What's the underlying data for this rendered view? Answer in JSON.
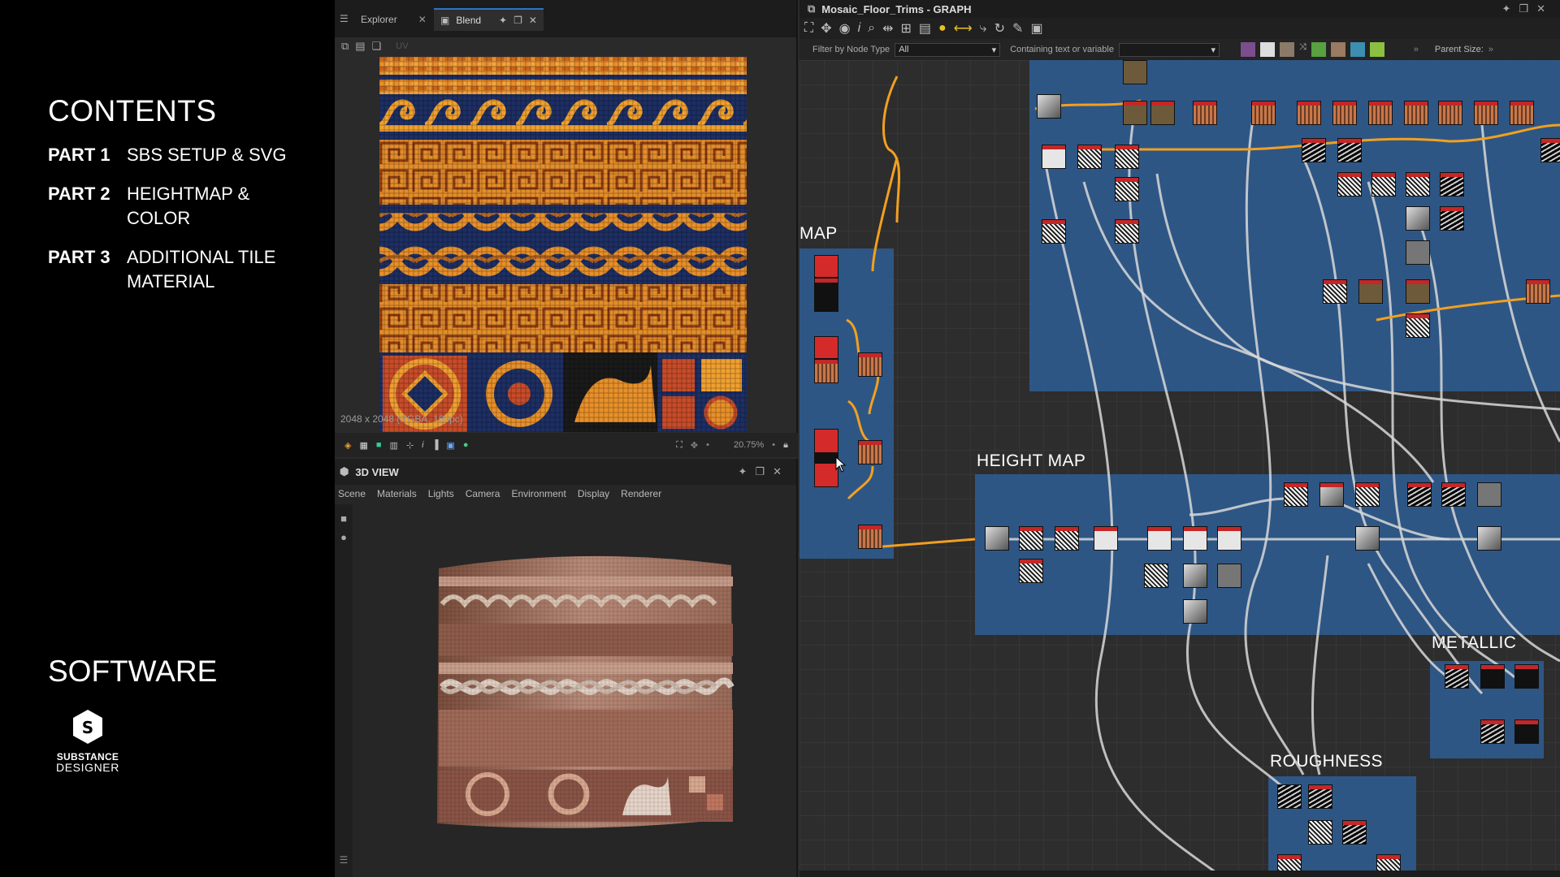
{
  "overlay": {
    "contents_title": "CONTENTS",
    "parts": [
      {
        "num": "PART 1",
        "title": "SBS SETUP & SVG"
      },
      {
        "num": "PART 2",
        "title": "HEIGHTMAP & COLOR"
      },
      {
        "num": "PART 3",
        "title": "ADDITIONAL TILE MATERIAL"
      }
    ],
    "software_title": "SOFTWARE",
    "logo_line1": "SUBSTANCE",
    "logo_line2": "DESIGNER"
  },
  "view2d": {
    "tab_explorer": "Explorer",
    "tab_blend": "Blend",
    "uv_label": "UV",
    "texture_info": "2048 x 2048 (RGBA, 16bpc)",
    "zoom": "20.75%"
  },
  "view3d": {
    "title": "3D VIEW",
    "menu": [
      "Scene",
      "Materials",
      "Lights",
      "Camera",
      "Environment",
      "Display",
      "Renderer"
    ]
  },
  "graph": {
    "title": "Mosaic_Floor_Trims - GRAPH",
    "filter_label": "Filter by Node Type",
    "filter_value": "All",
    "containing_label": "Containing text or variable",
    "containing_value": "",
    "parent_size_label": "Parent Size:",
    "frames": {
      "map": "MAP",
      "height_map": "HEIGHT MAP",
      "metallic": "METALLIC",
      "roughness": "ROUGHNESS"
    }
  },
  "colors": {
    "frame_blue": "#2f5a8c",
    "wire_orange": "#f2a020",
    "tile_orange": "#e8902a",
    "tile_blue": "#1d2f63",
    "tab_accent": "#2d74c4"
  }
}
